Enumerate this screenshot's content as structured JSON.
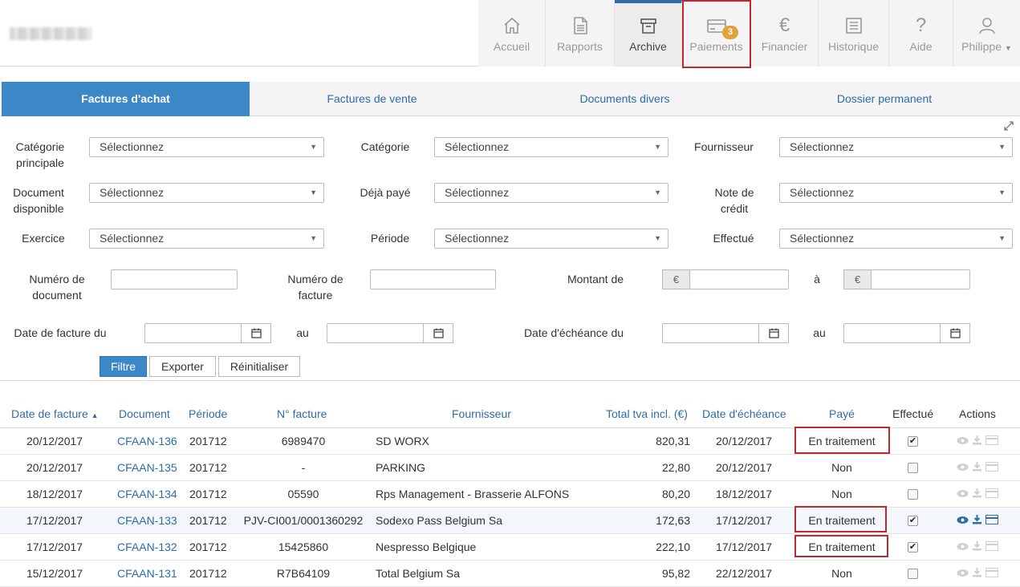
{
  "header": {
    "nav": [
      {
        "key": "home",
        "label": "Accueil",
        "icon": "home-icon"
      },
      {
        "key": "reports",
        "label": "Rapports",
        "icon": "document-icon"
      },
      {
        "key": "archive",
        "label": "Archive",
        "icon": "archive-icon",
        "active": true
      },
      {
        "key": "payments",
        "label": "Paiements",
        "icon": "card-icon",
        "badge": "3"
      },
      {
        "key": "finance",
        "label": "Financier",
        "icon": "euro-icon"
      },
      {
        "key": "history",
        "label": "Historique",
        "icon": "list-icon"
      },
      {
        "key": "help",
        "label": "Aide",
        "icon": "help-icon"
      },
      {
        "key": "user",
        "label": "Philippe",
        "icon": "user-icon"
      }
    ]
  },
  "tabs": [
    "Factures d'achat",
    "Factures de vente",
    "Documents divers",
    "Dossier permanent"
  ],
  "filters": {
    "placeholder": "Sélectionnez",
    "labels": {
      "main_category": [
        "Catégorie",
        "principale"
      ],
      "category": "Catégorie",
      "supplier": "Fournisseur",
      "doc_available": [
        "Document",
        "disponible"
      ],
      "already_paid": "Déjà payé",
      "credit_note": [
        "Note de",
        "crédit"
      ],
      "fiscal_year": "Exercice",
      "period": "Période",
      "done": "Effectué",
      "doc_number": [
        "Numéro de",
        "document"
      ],
      "invoice_number": [
        "Numéro de",
        "facture"
      ],
      "amount_from": "Montant de",
      "amount_to": "à",
      "invoice_date_from": "Date de facture du",
      "invoice_date_to": "au",
      "due_date_from": "Date d'échéance du",
      "due_date_to": "au"
    },
    "currency": "€",
    "buttons": {
      "filter": "Filtre",
      "export": "Exporter",
      "reset": "Réinitialiser"
    }
  },
  "table": {
    "columns": [
      "Date de facture",
      "Document",
      "Période",
      "N° facture",
      "Fournisseur",
      "Total tva incl. (€)",
      "Date d'échéance",
      "Payé",
      "Effectué",
      "Actions"
    ],
    "rows": [
      {
        "date": "20/12/2017",
        "doc": "CFAAN-136",
        "period": "201712",
        "num": "6989470",
        "supplier": "SD WORX",
        "total": "820,31",
        "due": "20/12/2017",
        "paid": "En traitement",
        "done": true
      },
      {
        "date": "20/12/2017",
        "doc": "CFAAN-135",
        "period": "201712",
        "num": "-",
        "supplier": "PARKING",
        "total": "22,80",
        "due": "20/12/2017",
        "paid": "Non",
        "done": false
      },
      {
        "date": "18/12/2017",
        "doc": "CFAAN-134",
        "period": "201712",
        "num": "05590",
        "supplier": "Rps Management - Brasserie ALFONS",
        "total": "80,20",
        "due": "18/12/2017",
        "paid": "Non",
        "done": false
      },
      {
        "date": "17/12/2017",
        "doc": "CFAAN-133",
        "period": "201712",
        "num": "PJV-CI001/0001360292",
        "supplier": "Sodexo Pass Belgium Sa",
        "total": "172,63",
        "due": "17/12/2017",
        "paid": "En traitement",
        "done": true
      },
      {
        "date": "17/12/2017",
        "doc": "CFAAN-132",
        "period": "201712",
        "num": "15425860",
        "supplier": "Nespresso Belgique",
        "total": "222,10",
        "due": "17/12/2017",
        "paid": "En traitement",
        "done": true
      },
      {
        "date": "15/12/2017",
        "doc": "CFAAN-131",
        "period": "201712",
        "num": "R7B64109",
        "supplier": "Total Belgium Sa",
        "total": "95,82",
        "due": "22/12/2017",
        "paid": "Non",
        "done": false
      }
    ]
  },
  "colors": {
    "accent": "#3c87c8",
    "link": "#2d6ca8",
    "highlight": "#c0282d",
    "badge": "#e0a23a"
  }
}
